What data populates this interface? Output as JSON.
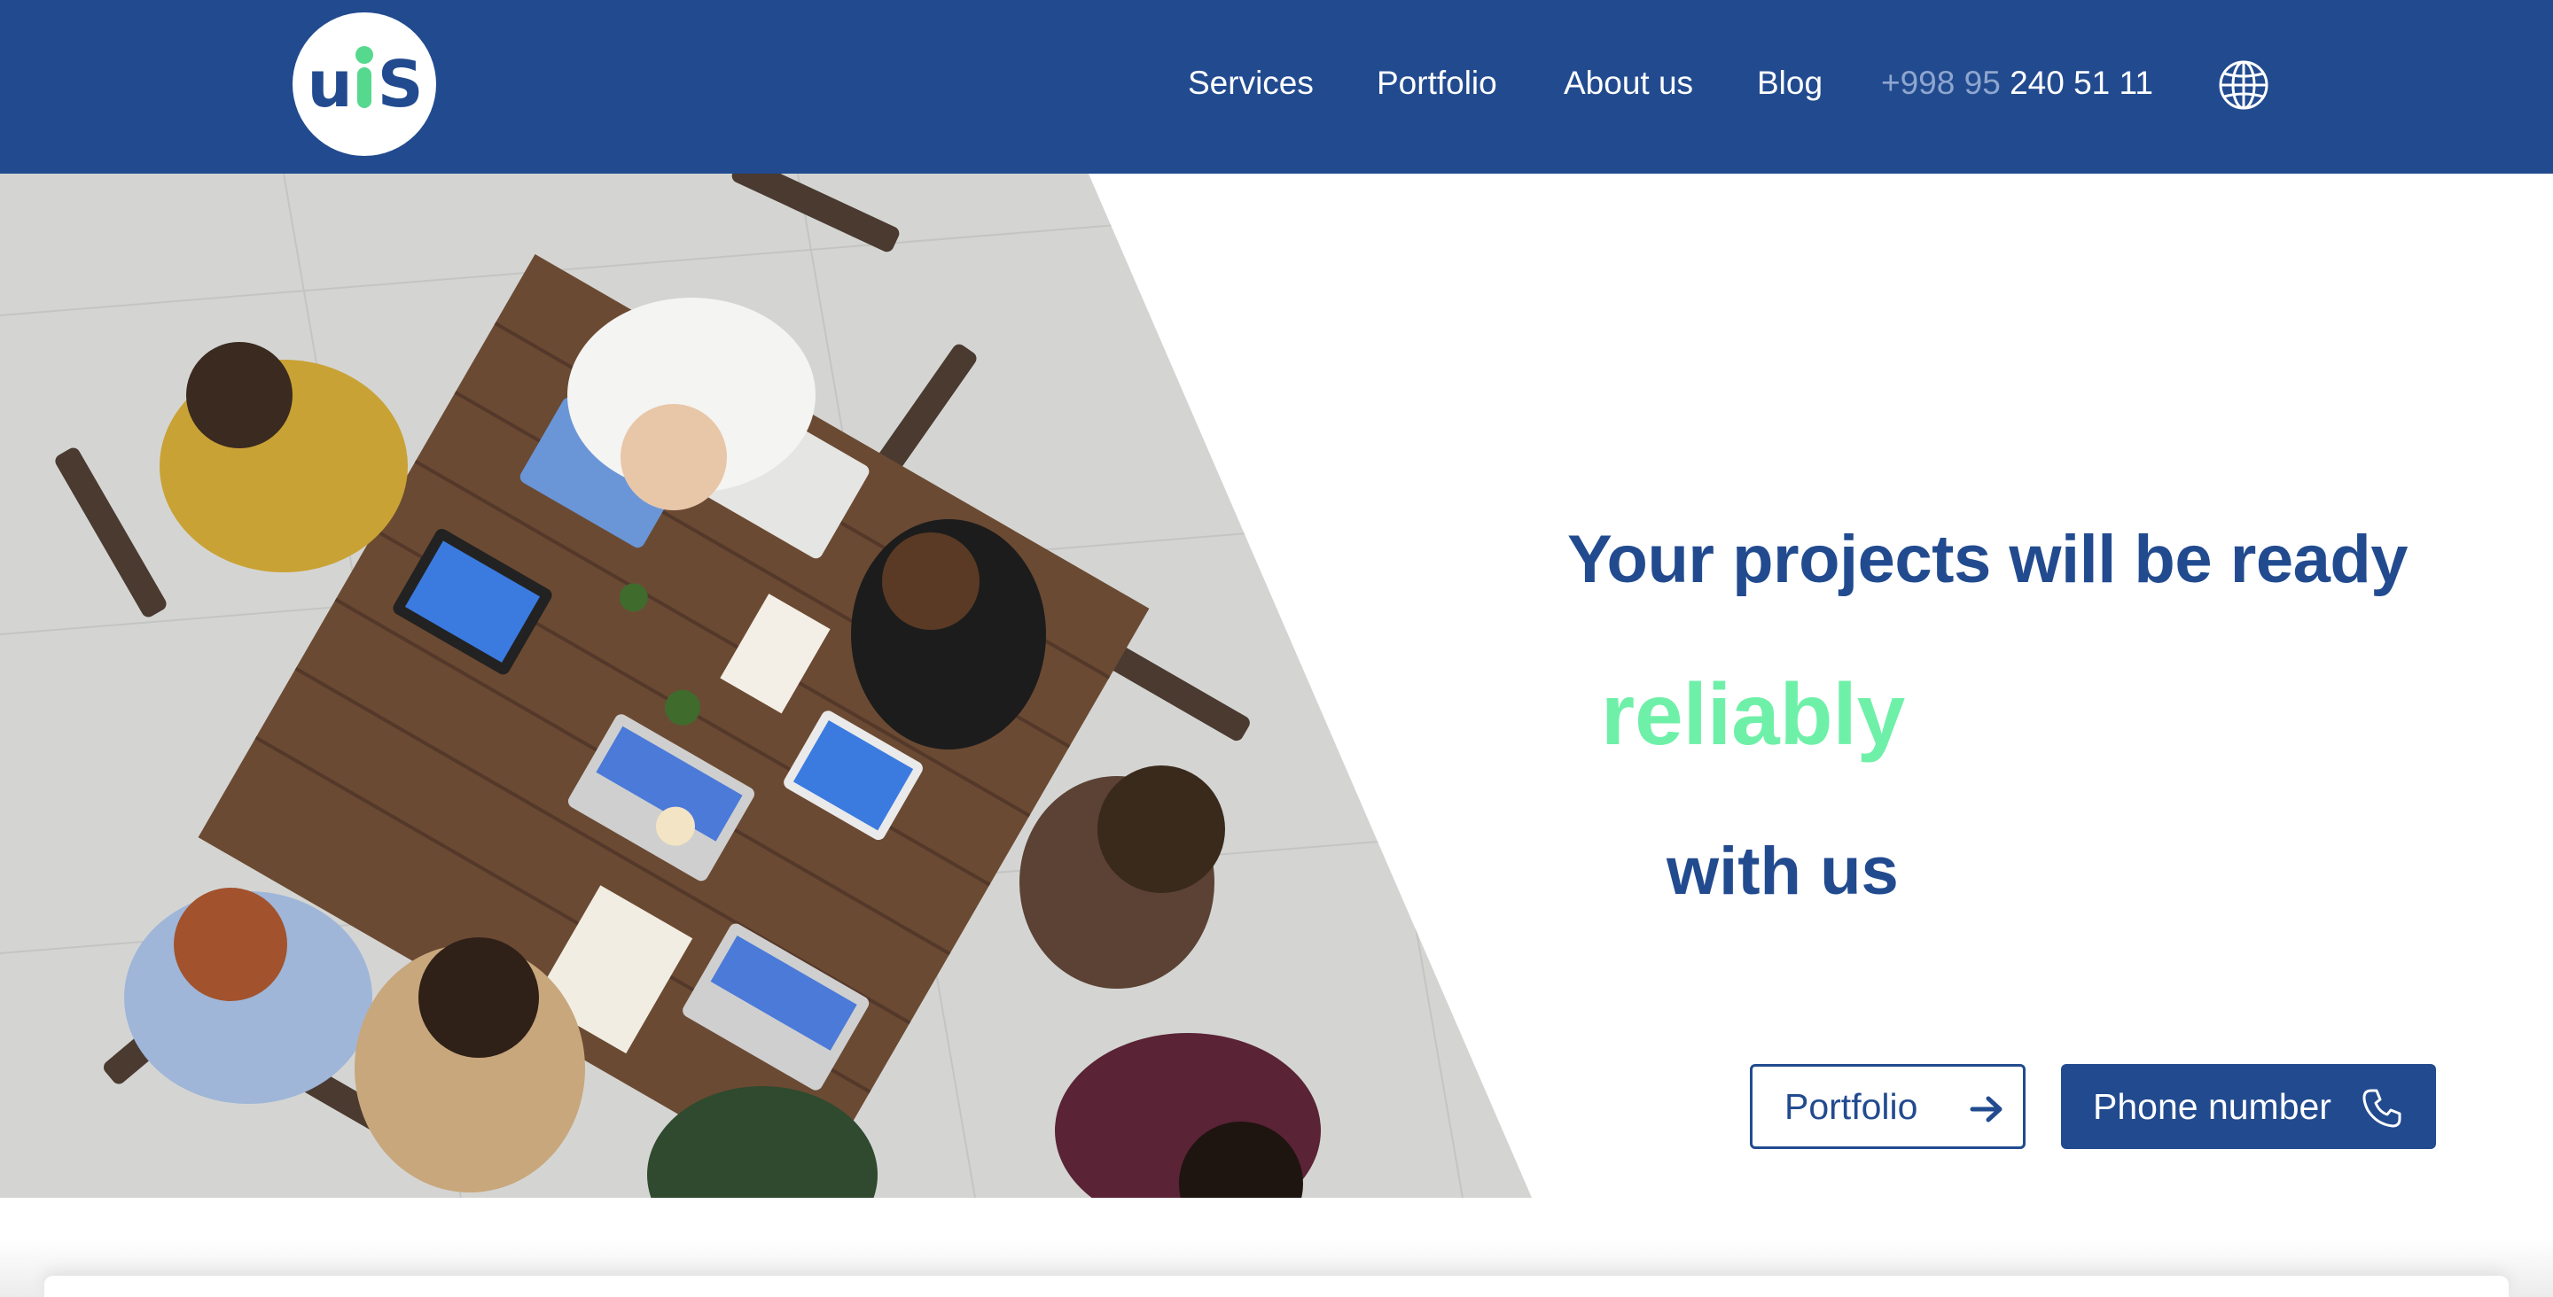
{
  "header": {
    "logo_text_left": "u",
    "logo_text_right": "S",
    "nav": {
      "services": "Services",
      "portfolio": "Portfolio",
      "about": "About us",
      "blog": "Blog"
    },
    "phone_code": "+998 95",
    "phone_number": "240 51 11",
    "language_icon": "globe-icon"
  },
  "hero": {
    "headline_line1": "Your projects will be ready",
    "headline_line2": "reliably",
    "headline_line3": "with us",
    "image_alt": "team meeting photo",
    "buttons": {
      "portfolio_label": "Portfolio",
      "portfolio_icon": "arrow-right-icon",
      "phone_label": "Phone number",
      "phone_icon": "phone-icon"
    }
  },
  "colors": {
    "brand_blue": "#224b8f",
    "accent_green": "#6ff0a8",
    "muted_blue": "#8ea6cf"
  }
}
